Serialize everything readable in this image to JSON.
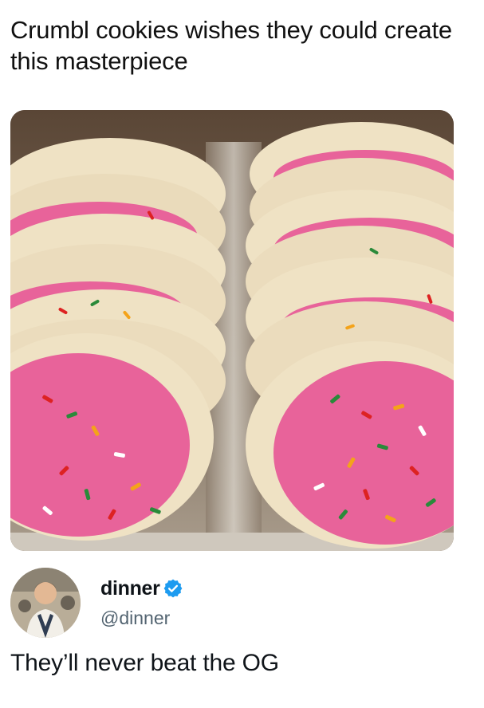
{
  "post": {
    "caption": "Crumbl cookies wishes they could create this masterpiece"
  },
  "photo": {
    "icon": "frosted-sugar-cookies-photo"
  },
  "tweet": {
    "display_name": "dinner",
    "handle": "@dinner",
    "text": "They’ll never beat the OG",
    "verified": true
  },
  "colors": {
    "text": "#0f1419",
    "handle": "#536471",
    "verified_badge": "#1d9bf0",
    "frosting_pink": "#e8639a",
    "cookie_cream": "#efe2c4"
  }
}
